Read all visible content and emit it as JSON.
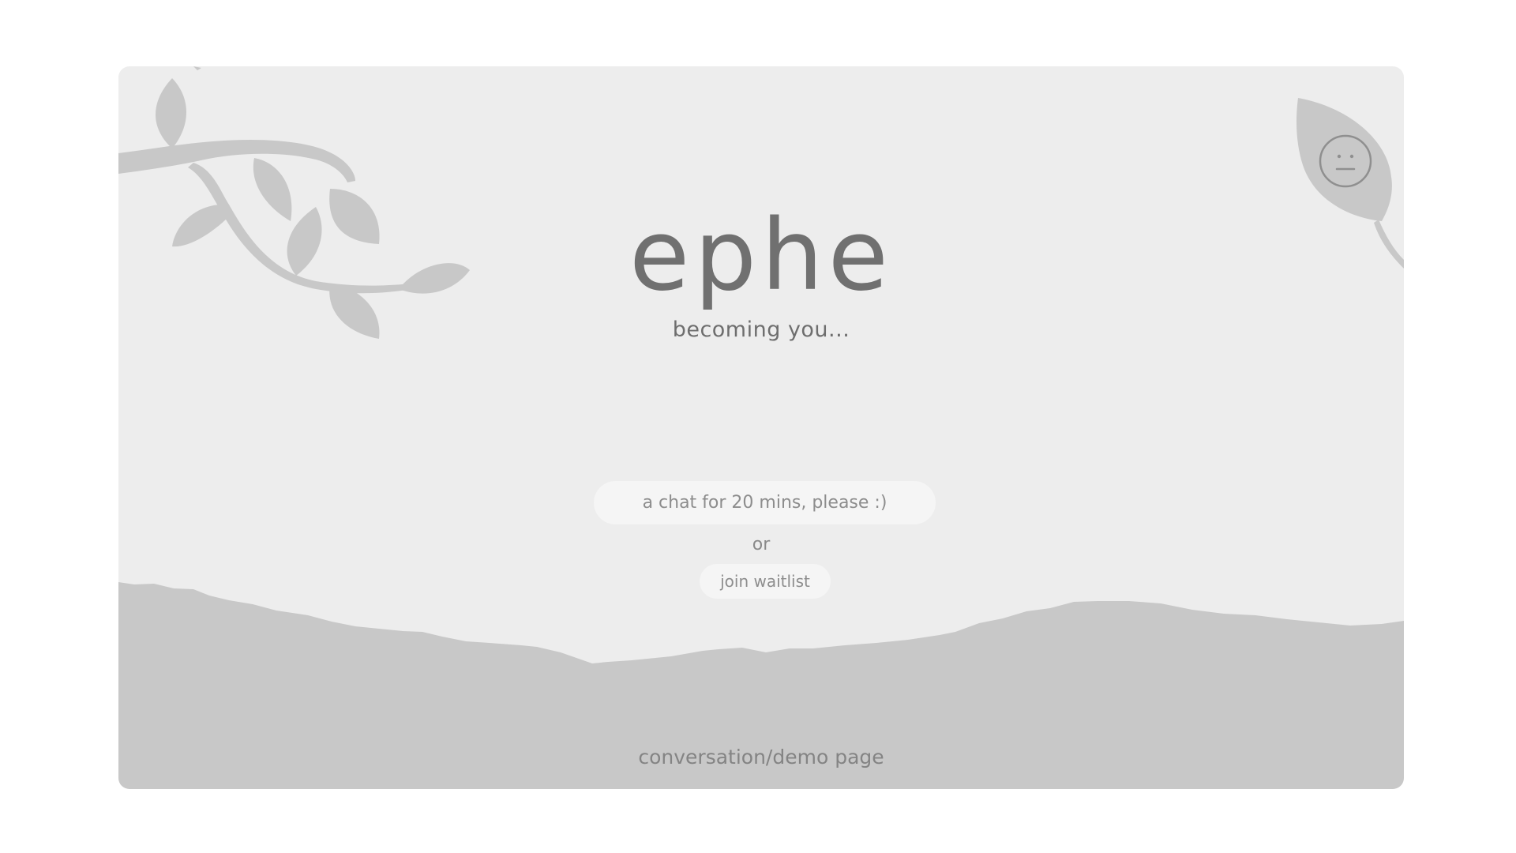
{
  "app": {
    "title": "ephe",
    "tagline": "becoming you..."
  },
  "actions": {
    "primary_label": "a chat for 20 mins, please :)",
    "separator": "or",
    "secondary_label": "join waitlist"
  },
  "footer": {
    "label": "conversation/demo page"
  },
  "icons": {
    "avatar": "neutral-face-icon",
    "decor_left": "branch-leaves",
    "decor_right": "leaf"
  },
  "colors": {
    "background": "#ededed",
    "ground": "#c8c8c8",
    "foliage": "#c8c8c8",
    "text": "#707070",
    "button": "#f5f5f5"
  }
}
